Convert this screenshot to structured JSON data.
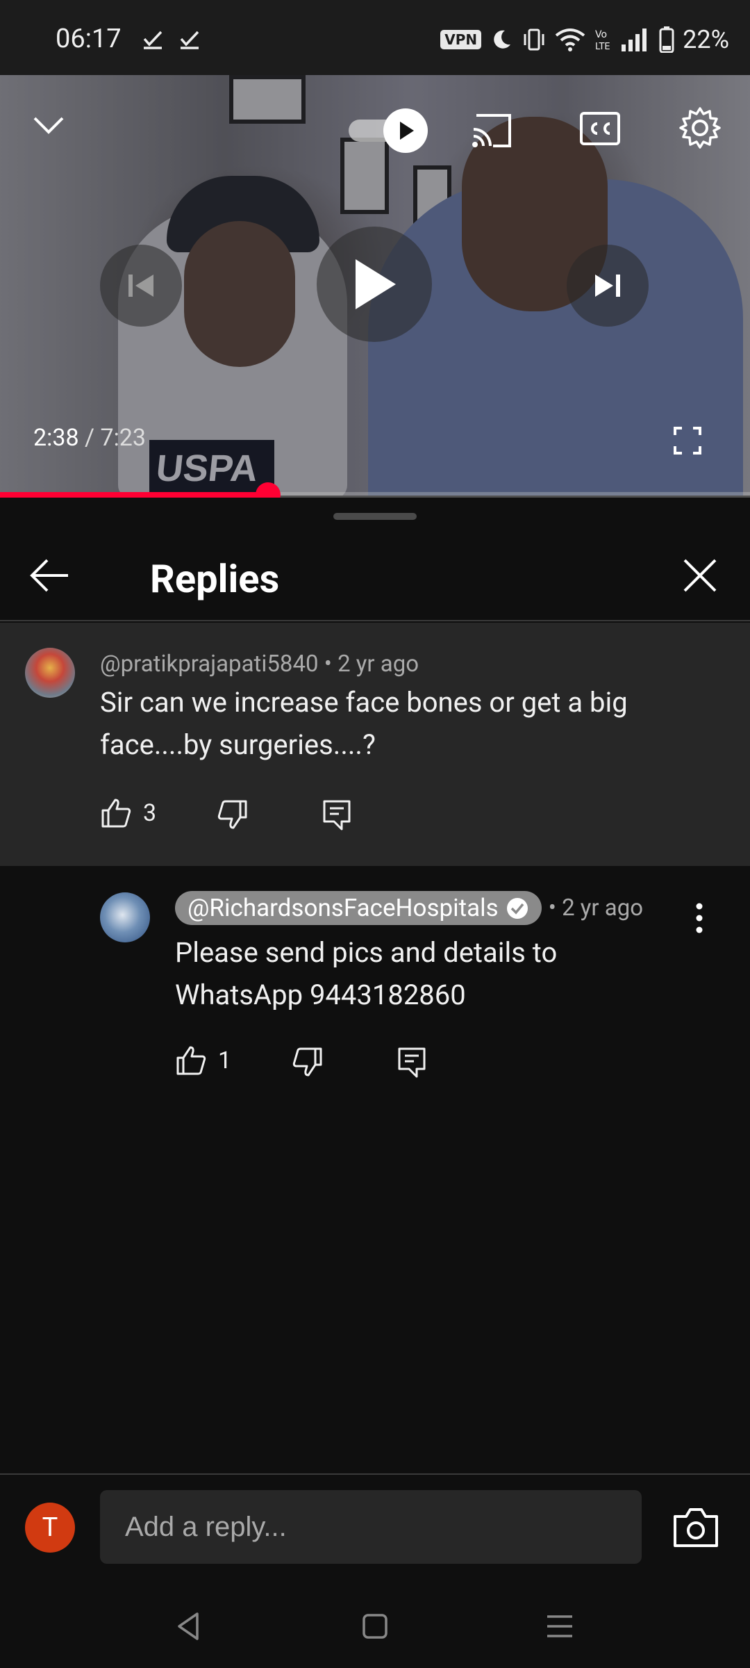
{
  "status_bar": {
    "time": "06:17",
    "vpn_badge": "VPN",
    "battery": "22%"
  },
  "player": {
    "current_time": "2:38",
    "separator": " / ",
    "duration": "7:23",
    "progress_fraction": 0.357,
    "autoplay_on": true,
    "shirt_text": "USPA"
  },
  "sheet": {
    "title": "Replies"
  },
  "parent_comment": {
    "handle": "@pratikprajapati5840",
    "age": "• 2 yr ago",
    "text": "Sir can we increase face bones or get a big face....by surgeries....?",
    "likes": "3"
  },
  "reply": {
    "handle": "@RichardsonsFaceHospitals",
    "verified": true,
    "age": "• 2 yr ago",
    "text": "Please send pics and details to WhatsApp 9443182860",
    "likes": "1"
  },
  "composer": {
    "avatar_letter": "T",
    "placeholder": "Add a reply..."
  },
  "colors": {
    "accent": "#ff0033",
    "background": "#0f0f0f",
    "parent_bg": "#272727",
    "avatar_bg": "#d13a11"
  }
}
